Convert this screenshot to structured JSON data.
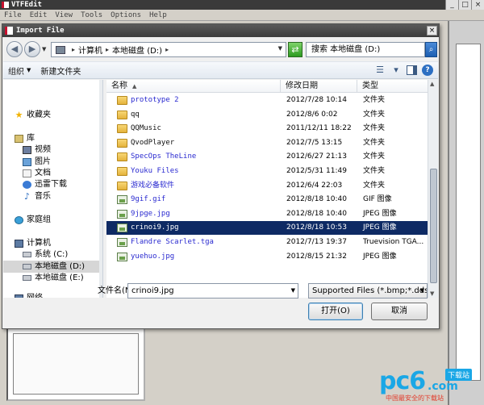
{
  "app": {
    "title": "VTFEdit",
    "minimize": "_",
    "maximize": "□",
    "close": "×",
    "menu": [
      "File",
      "Edit",
      "View",
      "Tools",
      "Options",
      "Help"
    ]
  },
  "dialog": {
    "title": "Import File",
    "close": "×",
    "address": {
      "segments": [
        "计算机",
        "本地磁盘 (D:)"
      ],
      "separator": "▸"
    },
    "search": {
      "placeholder": "搜索 本地磁盘 (D:)"
    },
    "toolbar": {
      "organize": "组织",
      "new_folder": "新建文件夹"
    },
    "nav": [
      {
        "label": "收藏夹",
        "icon": "star-icon"
      },
      {
        "label": "库",
        "icon": "library-icon"
      },
      {
        "label": "视频",
        "icon": "video-icon"
      },
      {
        "label": "图片",
        "icon": "picture-icon"
      },
      {
        "label": "文档",
        "icon": "document-icon"
      },
      {
        "label": "迅雷下载",
        "icon": "thunder-icon"
      },
      {
        "label": "音乐",
        "icon": "music-icon"
      },
      {
        "label": "家庭组",
        "icon": "homegroup-icon"
      },
      {
        "label": "计算机",
        "icon": "computer-icon"
      },
      {
        "label": "系统 (C:)",
        "icon": "drive-icon"
      },
      {
        "label": "本地磁盘 (D:)",
        "icon": "drive-icon",
        "selected": true
      },
      {
        "label": "本地磁盘 (E:)",
        "icon": "drive-icon"
      },
      {
        "label": "网络",
        "icon": "network-icon"
      }
    ],
    "columns": {
      "name": "名称",
      "date": "修改日期",
      "type": "类型"
    },
    "files": [
      {
        "name": "prototype 2",
        "date": "2012/7/28 10:14",
        "type": "文件夹",
        "kind": "folder"
      },
      {
        "name": "qq",
        "date": "2012/8/6 0:02",
        "type": "文件夹",
        "kind": "folder",
        "dark": true
      },
      {
        "name": "QQMusic",
        "date": "2011/12/11 18:22",
        "type": "文件夹",
        "kind": "folder",
        "dark": true
      },
      {
        "name": "QvodPlayer",
        "date": "2012/7/5 13:15",
        "type": "文件夹",
        "kind": "folder",
        "dark": true
      },
      {
        "name": "SpecOps TheLine",
        "date": "2012/6/27 21:13",
        "type": "文件夹",
        "kind": "folder"
      },
      {
        "name": "Youku Files",
        "date": "2012/5/31 11:49",
        "type": "文件夹",
        "kind": "folder"
      },
      {
        "name": "游戏必备软件",
        "date": "2012/6/4 22:03",
        "type": "文件夹",
        "kind": "folder"
      },
      {
        "name": "9gif.gif",
        "date": "2012/8/18 10:40",
        "type": "GIF 图像",
        "kind": "image"
      },
      {
        "name": "9jpge.jpg",
        "date": "2012/8/18 10:40",
        "type": "JPEG 图像",
        "kind": "image"
      },
      {
        "name": "crinoi9.jpg",
        "date": "2012/8/18 10:53",
        "type": "JPEG 图像",
        "kind": "image",
        "selected": true
      },
      {
        "name": "Flandre Scarlet.tga",
        "date": "2012/7/13 19:37",
        "type": "Truevision TGA...",
        "kind": "image"
      },
      {
        "name": "yuehuo.jpg",
        "date": "2012/8/15 21:32",
        "type": "JPEG 图像",
        "kind": "image"
      }
    ],
    "filename": {
      "label": "文件名(N):",
      "value": "crinoi9.jpg"
    },
    "filter": {
      "value": "Supported Files (*.bmp;*.dds"
    },
    "buttons": {
      "open": "打开(O)",
      "cancel": "取消"
    }
  },
  "watermark": {
    "logo": "pc6",
    "dot": ".com",
    "badge": "下载站",
    "tagline": "中国最安全的下载站"
  }
}
